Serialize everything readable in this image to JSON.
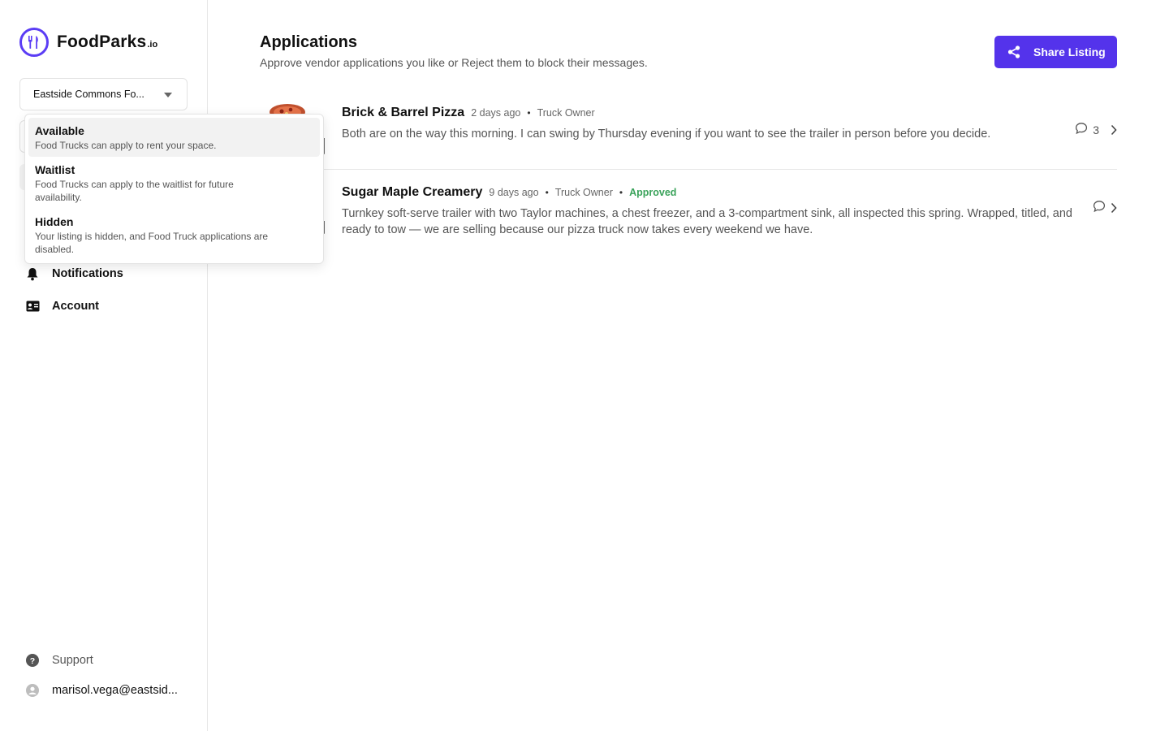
{
  "brand": {
    "name": "FoodParks",
    "suffix": ".io",
    "accent": "#5433eb"
  },
  "sidebar": {
    "park_select": {
      "value": "Eastside Commons Fo..."
    },
    "nav": [
      {
        "label": "Notifications",
        "icon": "bell-icon"
      },
      {
        "label": "Account",
        "icon": "id-card-icon"
      }
    ],
    "support_label": "Support",
    "user_email": "marisol.vega@eastsid..."
  },
  "status_dropdown": {
    "options": [
      {
        "title": "Available",
        "description": "Food Trucks can apply to rent your space.",
        "selected": true
      },
      {
        "title": "Waitlist",
        "description": "Food Trucks can apply to the waitlist for future availability.",
        "selected": false
      },
      {
        "title": "Hidden",
        "description": "Your listing is hidden, and Food Truck applications are disabled.",
        "selected": false
      }
    ]
  },
  "main": {
    "title": "Applications",
    "subtitle": "Approve vendor applications you like or Reject them to block their messages.",
    "share_label": "Share Listing",
    "applications": [
      {
        "name": "Brick & Barrel Pizza",
        "time": "2 days ago",
        "role": "Truck Owner",
        "status": "",
        "message": "Both are on the way this morning. I can swing by Thursday evening if you want to see the trailer in person before you decide.",
        "comment_count": "3"
      },
      {
        "name": "Sugar Maple Creamery",
        "time": "9 days ago",
        "role": "Truck Owner",
        "status": "Approved",
        "message": "Turnkey soft-serve trailer with two Taylor machines, a chest freezer, and a 3-compartment sink, all inspected this spring. Wrapped, titled, and ready to tow — we are selling because our pizza truck now takes every weekend we have.",
        "comment_count": ""
      }
    ]
  },
  "colors": {
    "approved": "#3ba35b",
    "border": "#e6e6e6"
  }
}
